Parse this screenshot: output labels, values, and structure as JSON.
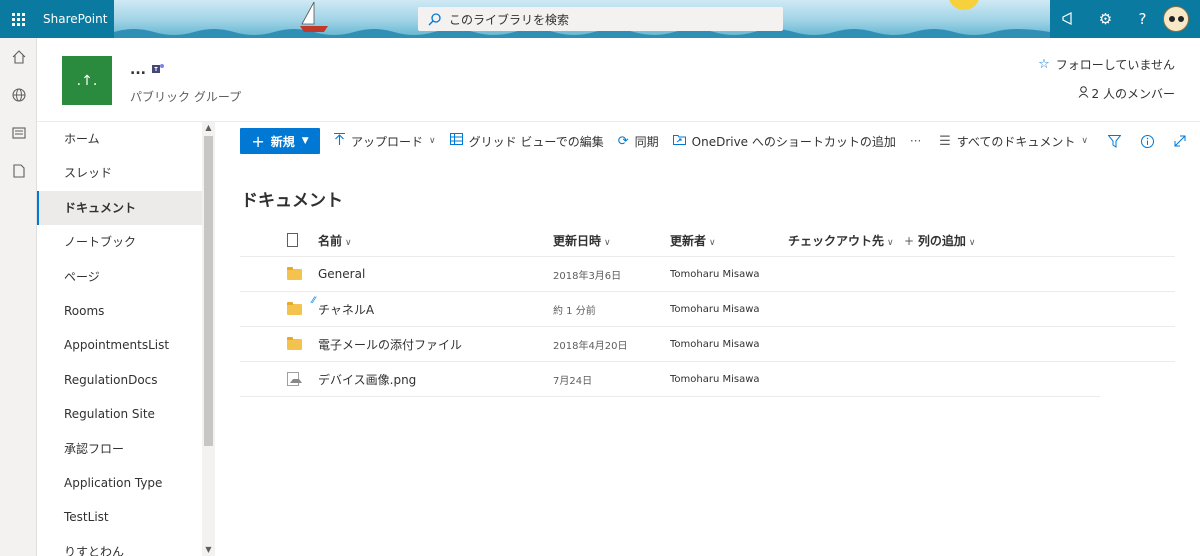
{
  "suite": {
    "brand": "SharePoint",
    "search_placeholder": "このライブラリを検索"
  },
  "site": {
    "logo_text": ".↑.",
    "title": "...",
    "subtitle": "パブリック グループ",
    "follow": "フォローしていません",
    "members": "2 人のメンバー"
  },
  "nav": {
    "items": [
      {
        "label": "ホーム",
        "selected": false
      },
      {
        "label": "スレッド",
        "selected": false
      },
      {
        "label": "ドキュメント",
        "selected": true
      },
      {
        "label": "ノートブック",
        "selected": false
      },
      {
        "label": "ページ",
        "selected": false
      },
      {
        "label": "Rooms",
        "selected": false
      },
      {
        "label": "AppointmentsList",
        "selected": false
      },
      {
        "label": "RegulationDocs",
        "selected": false
      },
      {
        "label": "Regulation Site",
        "selected": false
      },
      {
        "label": "承認フロー",
        "selected": false
      },
      {
        "label": "Application Type",
        "selected": false
      },
      {
        "label": "TestList",
        "selected": false
      },
      {
        "label": "りすとわん",
        "selected": false
      }
    ]
  },
  "commands": {
    "new": "新規",
    "upload": "アップロード",
    "grid_edit": "グリッド ビューでの編集",
    "sync": "同期",
    "onedrive": "OneDrive へのショートカットの追加",
    "more": "···",
    "view": "すべてのドキュメント"
  },
  "main": {
    "title": "ドキュメント",
    "columns": {
      "name": "名前",
      "modified": "更新日時",
      "modified_by": "更新者",
      "checked_out": "チェックアウト先",
      "add_column": "列の追加"
    },
    "rows": [
      {
        "type": "folder",
        "name": "General",
        "modified": "2018年3月6日",
        "modified_by": "Tomoharu Misawa"
      },
      {
        "type": "folder",
        "name": "チャネルA",
        "modified": "約 1 分前",
        "modified_by": "Tomoharu Misawa"
      },
      {
        "type": "folder",
        "name": "電子メールの添付ファイル",
        "modified": "2018年4月20日",
        "modified_by": "Tomoharu Misawa"
      },
      {
        "type": "image",
        "name": "デバイス画像.png",
        "modified": "7月24日",
        "modified_by": "Tomoharu Misawa"
      }
    ]
  },
  "colors": {
    "brand": "#0a7aa0",
    "accent": "#0078d4",
    "site_logo": "#2a8a3e"
  }
}
